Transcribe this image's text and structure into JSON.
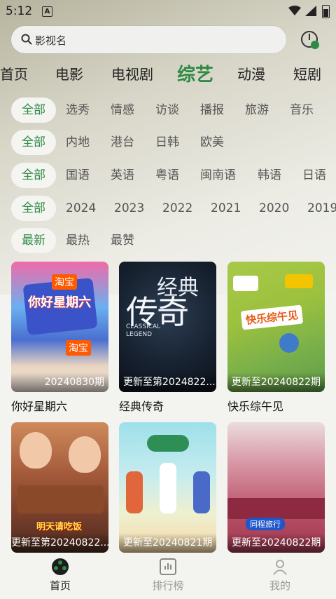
{
  "status_bar": {
    "time": "5:12",
    "notif_icon": "A"
  },
  "search": {
    "placeholder": "影视名"
  },
  "category_tabs": [
    {
      "label": "首页"
    },
    {
      "label": "电影"
    },
    {
      "label": "电视剧"
    },
    {
      "label": "综艺",
      "active": true
    },
    {
      "label": "动漫"
    },
    {
      "label": "短剧"
    }
  ],
  "filters": {
    "genre": [
      "全部",
      "选秀",
      "情感",
      "访谈",
      "播报",
      "旅游",
      "音乐"
    ],
    "region": [
      "全部",
      "内地",
      "港台",
      "日韩",
      "欧美"
    ],
    "language": [
      "全部",
      "国语",
      "英语",
      "粤语",
      "闽南语",
      "韩语",
      "日语"
    ],
    "year": [
      "全部",
      "2024",
      "2023",
      "2022",
      "2021",
      "2020",
      "2019"
    ],
    "sort": [
      "最新",
      "最热",
      "最赞"
    ]
  },
  "cards": [
    {
      "title": "你好星期六",
      "tag": "20240830期"
    },
    {
      "title": "经典传奇",
      "tag": "更新至第2024822..."
    },
    {
      "title": "快乐综午见",
      "tag": "更新至20240822期"
    },
    {
      "title": "",
      "tag": "更新至第20240822..."
    },
    {
      "title": "",
      "tag": "更新至20240821期"
    },
    {
      "title": "",
      "tag": "更新至20240822期"
    }
  ],
  "poster_texts": {
    "p1_brand": "淘宝",
    "p1_title": "你好星期六",
    "p2_title": "传奇",
    "p2_sub": "经典",
    "p2_en": "CLASSICAL LEGEND",
    "p3_title": "快乐综午见",
    "p4_title": "明天请吃饭",
    "p6_brand": "同程旅行"
  },
  "bottom_nav": [
    {
      "label": "首页",
      "icon": "film-reel-icon",
      "active": true
    },
    {
      "label": "排行榜",
      "icon": "bar-chart-icon"
    },
    {
      "label": "我的",
      "icon": "user-icon"
    }
  ],
  "colors": {
    "accent": "#2f8a45",
    "background": "#f3f3ef"
  }
}
